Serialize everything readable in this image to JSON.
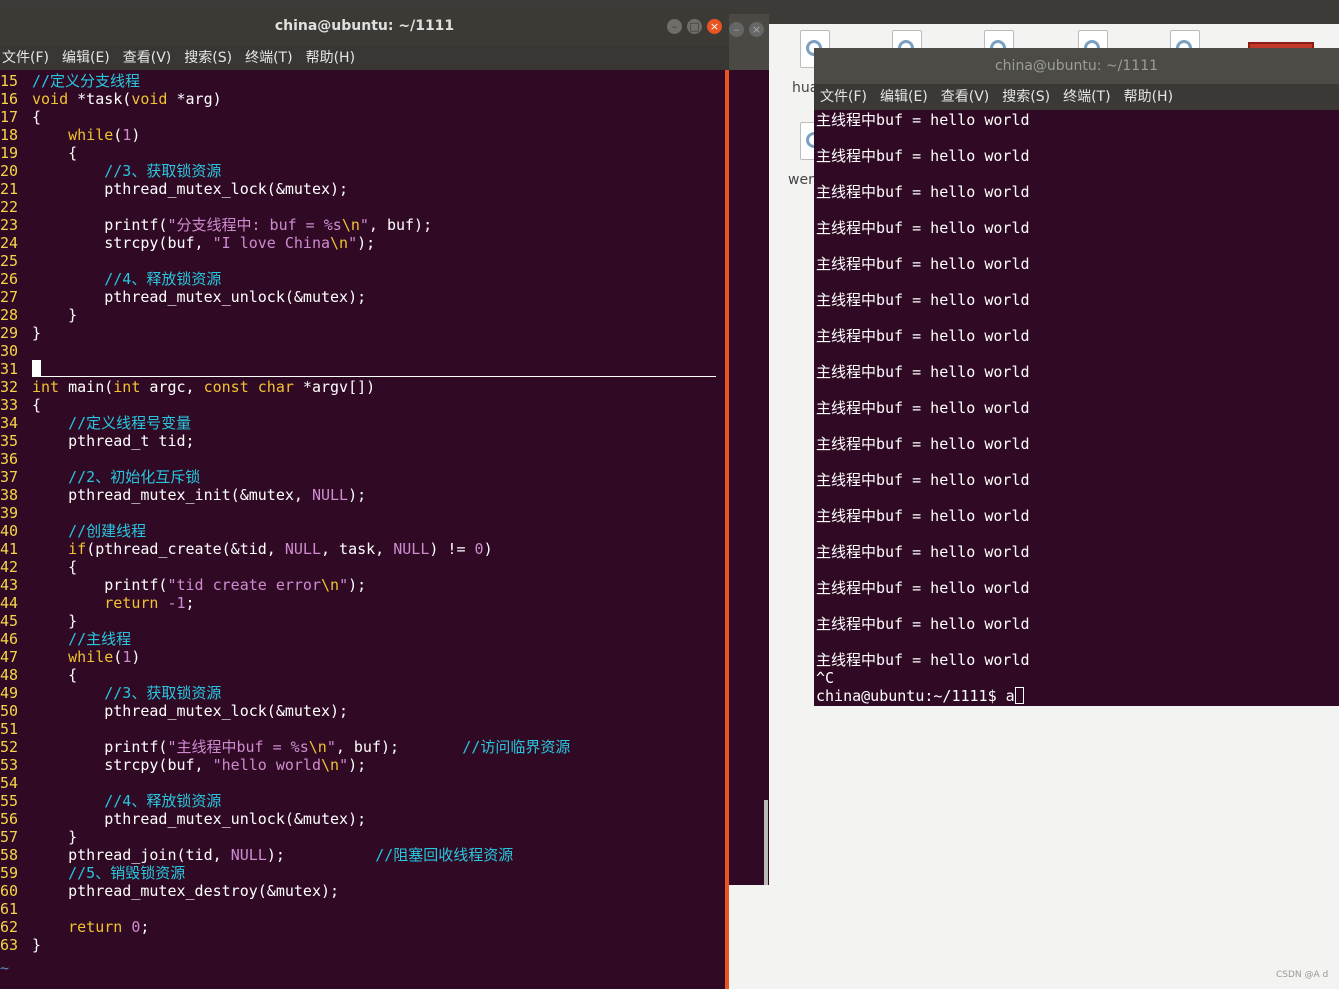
{
  "editor": {
    "title": "china@ubuntu: ~/1111",
    "menu": [
      "文件(F)",
      "编辑(E)",
      "查看(V)",
      "搜索(S)",
      "终端(T)",
      "帮助(H)"
    ],
    "lines": [
      {
        "n": "15",
        "html": "<span class='cm'>//定义分支线程</span>"
      },
      {
        "n": "16",
        "html": "<span class='kw'>void</span> *task(<span class='kw'>void</span> *arg)"
      },
      {
        "n": "17",
        "html": "{"
      },
      {
        "n": "18",
        "html": "    <span class='kw'>while</span>(<span class='st'>1</span>)"
      },
      {
        "n": "19",
        "html": "    {"
      },
      {
        "n": "20",
        "html": "        <span class='cm'>//3、获取锁资源</span>"
      },
      {
        "n": "21",
        "html": "        pthread_mutex_lock(&amp;mutex);"
      },
      {
        "n": "22",
        "html": ""
      },
      {
        "n": "23",
        "html": "        printf(<span class='st'>\"分支线程中: buf = %s</span><span class='kw'>\\n</span><span class='st'>\"</span>, buf);"
      },
      {
        "n": "24",
        "html": "        strcpy(buf, <span class='st'>\"I love China</span><span class='kw'>\\n</span><span class='st'>\"</span>);"
      },
      {
        "n": "25",
        "html": ""
      },
      {
        "n": "26",
        "html": "        <span class='cm'>//4、释放锁资源</span>"
      },
      {
        "n": "27",
        "html": "        pthread_mutex_unlock(&amp;mutex);"
      },
      {
        "n": "28",
        "html": "    }"
      },
      {
        "n": "29",
        "html": "}"
      },
      {
        "n": "30",
        "html": ""
      },
      {
        "n": "31",
        "html": "<span class='cursor'></span>"
      },
      {
        "n": "32",
        "html": "<span class='kw'>int</span> main(<span class='kw'>int</span> argc, <span class='kw'>const</span> <span class='kw'>char</span> *argv[])"
      },
      {
        "n": "33",
        "html": "{"
      },
      {
        "n": "34",
        "html": "    <span class='cm'>//定义线程号变量</span>"
      },
      {
        "n": "35",
        "html": "    pthread_t tid;"
      },
      {
        "n": "36",
        "html": ""
      },
      {
        "n": "37",
        "html": "    <span class='cm'>//2、初始化互斥锁</span>"
      },
      {
        "n": "38",
        "html": "    pthread_mutex_init(&amp;mutex, <span class='st'>NULL</span>);"
      },
      {
        "n": "39",
        "html": ""
      },
      {
        "n": "40",
        "html": "    <span class='cm'>//创建线程</span>"
      },
      {
        "n": "41",
        "html": "    <span class='kw'>if</span>(pthread_create(&amp;tid, <span class='st'>NULL</span>, task, <span class='st'>NULL</span>) != <span class='st'>0</span>)"
      },
      {
        "n": "42",
        "html": "    {"
      },
      {
        "n": "43",
        "html": "        printf(<span class='st'>\"tid create error</span><span class='kw'>\\n</span><span class='st'>\"</span>);"
      },
      {
        "n": "44",
        "html": "        <span class='kw'>return</span> <span class='st'>-1</span>;"
      },
      {
        "n": "45",
        "html": "    }"
      },
      {
        "n": "46",
        "html": "    <span class='cm'>//主线程</span>"
      },
      {
        "n": "47",
        "html": "    <span class='kw'>while</span>(<span class='st'>1</span>)"
      },
      {
        "n": "48",
        "html": "    {"
      },
      {
        "n": "49",
        "html": "        <span class='cm'>//3、获取锁资源</span>"
      },
      {
        "n": "50",
        "html": "        pthread_mutex_lock(&amp;mutex);"
      },
      {
        "n": "51",
        "html": ""
      },
      {
        "n": "52",
        "html": "        printf(<span class='st'>\"主线程中buf = %s</span><span class='kw'>\\n</span><span class='st'>\"</span>, buf);       <span class='cm'>//访问临界资源</span>"
      },
      {
        "n": "53",
        "html": "        strcpy(buf, <span class='st'>\"hello world</span><span class='kw'>\\n</span><span class='st'>\"</span>);"
      },
      {
        "n": "54",
        "html": ""
      },
      {
        "n": "55",
        "html": "        <span class='cm'>//4、释放锁资源</span>"
      },
      {
        "n": "56",
        "html": "        pthread_mutex_unlock(&amp;mutex);"
      },
      {
        "n": "57",
        "html": "    }"
      },
      {
        "n": "58",
        "html": "    pthread_join(tid, <span class='st'>NULL</span>);          <span class='cm'>//阻塞回收线程资源</span>"
      },
      {
        "n": "59",
        "html": "    <span class='cm'>//5、销毁锁资源</span>"
      },
      {
        "n": "60",
        "html": "    pthread_mutex_destroy(&amp;mutex);"
      },
      {
        "n": "61",
        "html": ""
      },
      {
        "n": "62",
        "html": "    <span class='kw'>return</span> <span class='st'>0</span>;"
      },
      {
        "n": "63",
        "html": "}"
      }
    ],
    "tilde": "~"
  },
  "desktop": {
    "labels": [
      "hua",
      "wen"
    ]
  },
  "terminal": {
    "title": "china@ubuntu: ~/1111",
    "menu": [
      "文件(F)",
      "编辑(E)",
      "查看(V)",
      "搜索(S)",
      "终端(T)",
      "帮助(H)"
    ],
    "output_line": "主线程中buf = hello world",
    "repeat_count": 16,
    "interrupt": "^C",
    "prompt": "china@ubuntu:~/1111$ ",
    "typed": "a"
  },
  "watermark": "CSDN @A d"
}
